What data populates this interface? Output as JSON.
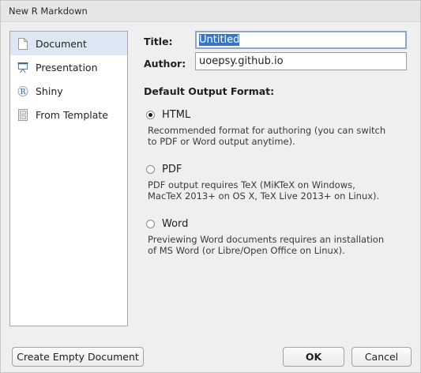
{
  "window": {
    "title": "New R Markdown"
  },
  "sidebar": {
    "items": [
      {
        "label": "Document",
        "icon": "document-icon",
        "selected": true
      },
      {
        "label": "Presentation",
        "icon": "presentation-icon",
        "selected": false
      },
      {
        "label": "Shiny",
        "icon": "shiny-r-icon",
        "selected": false
      },
      {
        "label": "From Template",
        "icon": "template-icon",
        "selected": false
      }
    ]
  },
  "form": {
    "title_label": "Title:",
    "title_value": "Untitled",
    "author_label": "Author:",
    "author_value": "uoepsy.github.io"
  },
  "output": {
    "section_title": "Default Output Format:",
    "options": [
      {
        "label": "HTML",
        "checked": true,
        "description_line1": "Recommended format for authoring (you can switch",
        "description_line2": "to PDF or Word output anytime)."
      },
      {
        "label": "PDF",
        "checked": false,
        "description_line1": "PDF output requires TeX (MiKTeX on Windows,",
        "description_line2": "MacTeX 2013+ on OS X, TeX Live 2013+ on Linux)."
      },
      {
        "label": "Word",
        "checked": false,
        "description_line1": "Previewing Word documents requires an installation",
        "description_line2": "of MS Word (or Libre/Open Office on Linux)."
      }
    ]
  },
  "buttons": {
    "create_empty": "Create Empty Document",
    "ok": "OK",
    "cancel": "Cancel"
  }
}
